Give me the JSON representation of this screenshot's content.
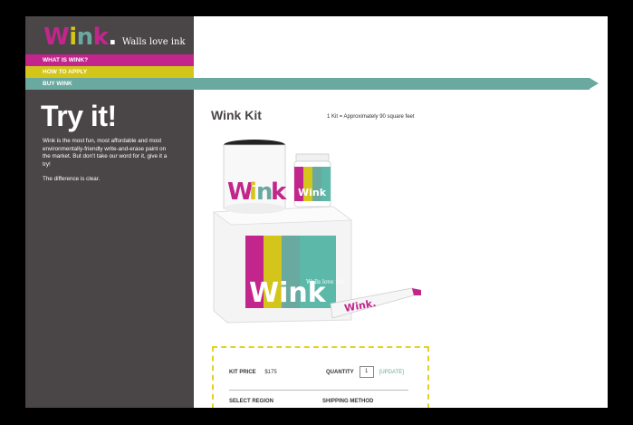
{
  "brand": {
    "logo_text": "Wink.",
    "tagline": "Walls love ink",
    "colors": {
      "magenta": "#c2268c",
      "yellow": "#d3c51a",
      "teal": "#6aa9a0",
      "sidebar_bg": "#4a4546"
    }
  },
  "nav": {
    "items": [
      {
        "label": "WHAT IS WINK?"
      },
      {
        "label": "HOW TO APPLY"
      },
      {
        "label": "BUY WINK"
      }
    ]
  },
  "sidebar": {
    "heading": "Try it!",
    "paragraph1": "Wink is the most fun, most affordable and most environmentally-friendly write-and-erase paint on the market. But don’t take our word for it, give it a try!",
    "paragraph2": "The difference is clear."
  },
  "main": {
    "title": "Wink Kit",
    "note": "1 Kit = Approximately 90 square feet",
    "product_logo_text": "Wink",
    "product_tagline": "Walls love ink"
  },
  "purchase": {
    "kit_price_label": "KIT PRICE",
    "kit_price_value": "$175",
    "quantity_label": "QUANTITY",
    "quantity_value": "1",
    "update_label": "[UPDATE]",
    "region_label": "SELECT REGION",
    "shipping_label": "SHIPPING METHOD"
  }
}
